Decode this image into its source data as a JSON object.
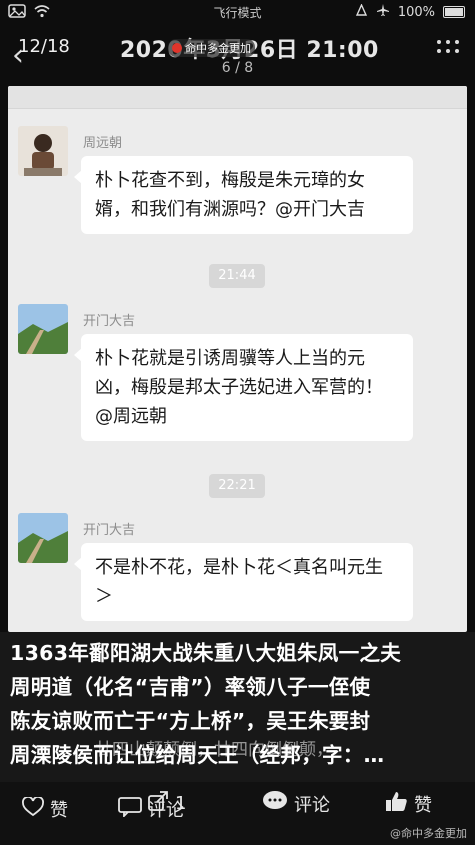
{
  "status": {
    "carrier_mode": "飞行模式",
    "battery": "100%"
  },
  "header": {
    "counter": "12/18",
    "datetime": "2020年3月26日 21:00",
    "watermark": "命中多金更加",
    "page_indicator": "6 / 8"
  },
  "chat": {
    "messages": [
      {
        "sender": "周远朝",
        "text": "朴卜花查不到，梅殷是朱元璋的女婿，和我们有渊源吗？@开门大吉"
      },
      {
        "time": "21:44"
      },
      {
        "sender": "开门大吉",
        "text": "朴卜花就是引诱周骥等人上当的元凶，梅殷是邦太子选妃进入军营的！@周远朝"
      },
      {
        "time": "22:21"
      },
      {
        "sender": "开门大吉",
        "text": "不是朴不花，是朴卜花＜真名叫元生＞"
      }
    ]
  },
  "caption": {
    "text": "1363年鄱阳湖大战朱重八大姐朱凤一之夫\n周明道（化名“吉甫”）率领八子一侄使\n陈友谅败而亡于“方上桥”，吴王朱要封\n周溧陵侯而让位给周天王（经邦，字：…",
    "overlay_line": "廿四山颠颠倒，廿四向倒倒颠，"
  },
  "bottom": {
    "like_label": "赞",
    "comment_label": "评论",
    "share_count": "1",
    "comment_label_2": "评论",
    "like_label_2": "赞",
    "watermark": "命中多金更加"
  }
}
